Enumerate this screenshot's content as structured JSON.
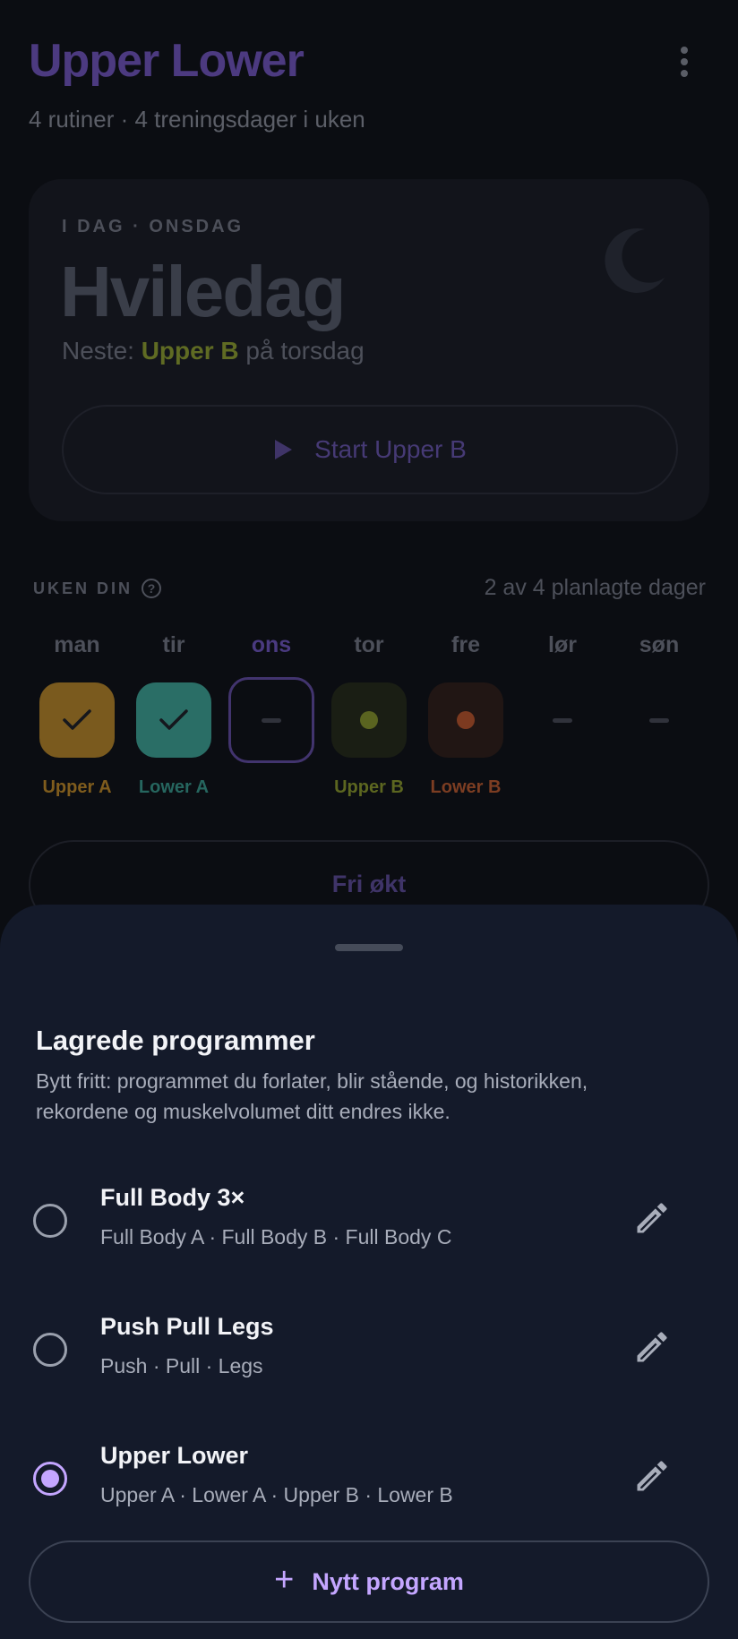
{
  "header": {
    "title": "Upper Lower",
    "subtitle": "4 rutiner · 4 treningsdager i uken"
  },
  "today": {
    "eyebrow": "I DAG · ONSDAG",
    "title": "Hviledag",
    "next_prefix": "Neste: ",
    "next_routine": "Upper B",
    "next_suffix": " på torsdag",
    "start_label": "Start Upper B"
  },
  "week": {
    "label": "UKEN DIN",
    "count_text": "2 av 4 planlagte dager",
    "days": [
      {
        "name": "man",
        "routine": "Upper A",
        "state": "done",
        "color": "#7a5a1e",
        "text_color": "#7f5c1d"
      },
      {
        "name": "tir",
        "routine": "Lower A",
        "state": "done",
        "color": "#2a6e66",
        "text_color": "#26665f"
      },
      {
        "name": "ons",
        "routine": "",
        "state": "today",
        "color": "#42346e",
        "text_color": ""
      },
      {
        "name": "tor",
        "routine": "Upper B",
        "state": "planned",
        "color": "#5a6420",
        "text_color": "#5c6620"
      },
      {
        "name": "fre",
        "routine": "Lower B",
        "state": "planned",
        "color": "#7c3a20",
        "text_color": "#7c3d22"
      },
      {
        "name": "lør",
        "routine": "",
        "state": "rest",
        "color": "",
        "text_color": ""
      },
      {
        "name": "søn",
        "routine": "",
        "state": "rest",
        "color": "",
        "text_color": ""
      }
    ]
  },
  "free_session_label": "Fri økt",
  "sheet": {
    "title": "Lagrede programmer",
    "description": "Bytt fritt: programmet du forlater, blir stående, og historikken, rekordene og muskelvolumet ditt endres ikke.",
    "programs": [
      {
        "name": "Full Body 3×",
        "days": "Full Body A · Full Body B · Full Body C",
        "selected": false
      },
      {
        "name": "Push Pull Legs",
        "days": "Push · Pull · Legs",
        "selected": false
      },
      {
        "name": "Upper Lower",
        "days": "Upper A · Lower A · Upper B · Lower B",
        "selected": true
      }
    ],
    "new_program_label": "Nytt program"
  },
  "icons": {
    "menu": "more-vert-icon",
    "moon": "moon-icon",
    "play": "play-icon",
    "help": "help-circle-icon",
    "check": "check-icon",
    "edit": "pencil-icon",
    "plus": "plus-icon"
  },
  "colors": {
    "accent": "#c4a6ff",
    "sheet_background": "#141a2a"
  }
}
